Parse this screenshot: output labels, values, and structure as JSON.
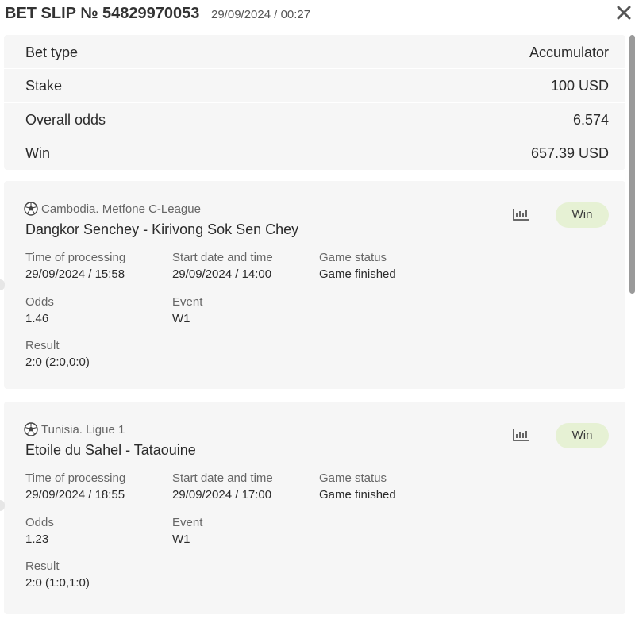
{
  "header": {
    "title": "BET SLIP № 54829970053",
    "datetime": "29/09/2024 / 00:27",
    "close_icon": "close-icon"
  },
  "summary": [
    {
      "label": "Bet type",
      "value": "Accumulator"
    },
    {
      "label": "Stake",
      "value": "100 USD"
    },
    {
      "label": "Overall odds",
      "value": "6.574"
    },
    {
      "label": "Win",
      "value": "657.39 USD"
    }
  ],
  "events": [
    {
      "league": "Cambodia. Metfone C-League",
      "match": "Dangkor Senchey - Kirivong Sok Sen Chey",
      "status_badge": "Win",
      "time_of_processing_label": "Time of processing",
      "time_of_processing": "29/09/2024 / 15:58",
      "start_label": "Start date and time",
      "start": "29/09/2024 / 14:00",
      "game_status_label": "Game status",
      "game_status": "Game finished",
      "odds_label": "Odds",
      "odds": "1.46",
      "event_label": "Event",
      "event": "W1",
      "result_label": "Result",
      "result": "2:0 (2:0,0:0)"
    },
    {
      "league": "Tunisia. Ligue 1",
      "match": "Etoile du Sahel - Tataouine",
      "status_badge": "Win",
      "time_of_processing_label": "Time of processing",
      "time_of_processing": "29/09/2024 / 18:55",
      "start_label": "Start date and time",
      "start": "29/09/2024 / 17:00",
      "game_status_label": "Game status",
      "game_status": "Game finished",
      "odds_label": "Odds",
      "odds": "1.23",
      "event_label": "Event",
      "event": "W1",
      "result_label": "Result",
      "result": "2:0 (1:0,1:0)"
    }
  ],
  "colors": {
    "card_bg": "#f6f6f6",
    "win_badge_bg": "#e6f1d4",
    "text": "#2b2b2b",
    "muted": "#666666"
  }
}
